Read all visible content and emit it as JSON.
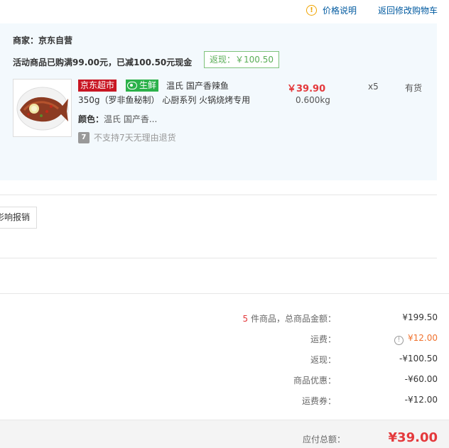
{
  "top": {
    "price_note": "价格说明",
    "back_to_cart": "返回修改购物车"
  },
  "shop": {
    "merchant": "商家：京东自营",
    "promo": "活动商品已购满99.00元，已减100.50元现金",
    "rebate_tag": "返现：￥100.50"
  },
  "item": {
    "badge_jd": "京东超市",
    "badge_fresh": "生鲜",
    "title_line1": "温氏 国产香辣鱼",
    "title_line2": "350g（罗非鱼秘制） 心厨系列 火锅烧烤专用",
    "color_label": "颜色：",
    "color_value": "温氏 国产香...",
    "no_return": "不支持7天无理由退货",
    "no_return_icon": "7",
    "price": "￥39.90",
    "weight": "0.600kg",
    "qty": "x5",
    "stock": "有货"
  },
  "invoice_button": "影响报销",
  "summary": {
    "count": "5",
    "count_suffix": " 件商品，总商品金额：",
    "total_goods": "¥199.50",
    "freight_label": "运费：",
    "freight": "¥12.00",
    "rebate_label": "返现：",
    "rebate": "-¥100.50",
    "discount_label": "商品优惠：",
    "discount": "-¥60.00",
    "coupon_label": "运费券：",
    "coupon": "-¥12.00"
  },
  "total": {
    "label": "应付总额：",
    "value": "¥39.00"
  },
  "colors": {
    "accent_red": "#e4393c",
    "link_blue": "#005aa0",
    "fresh_green": "#2bb14a",
    "jd_red": "#c81623"
  }
}
